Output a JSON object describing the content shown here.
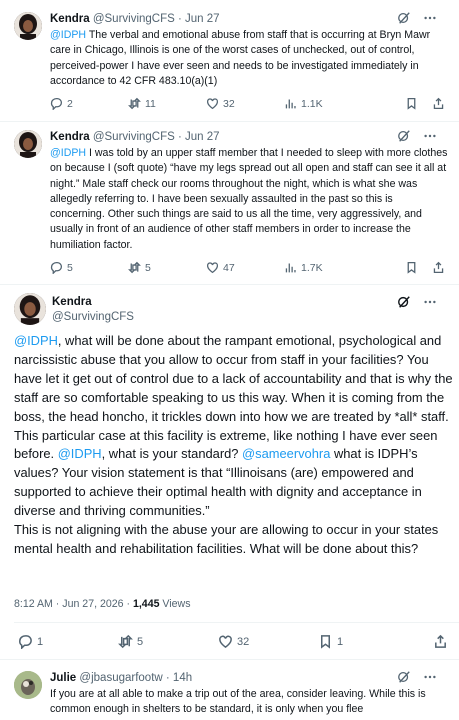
{
  "tweets": [
    {
      "name": "Kendra",
      "handle": "@SurvivingCFS",
      "time": "· Jun 27",
      "mention": "@IDPH",
      "text": " The verbal and emotional abuse from staff that is occurring at Bryn Mawr care in Chicago, Illinois is one of the worst cases of unchecked, out of control, perceived-power I have ever seen and needs to be investigated immediately in accordance to 42 CFR 483.10(a)(1)",
      "replies": "2",
      "retweets": "11",
      "likes": "32",
      "views": "1.1K"
    },
    {
      "name": "Kendra",
      "handle": "@SurvivingCFS",
      "time": "· Jun 27",
      "mention": "@IDPH",
      "text": " I was told by an upper staff member that I needed to sleep with more clothes on because I (soft quote) “have my legs spread out all open and staff can see it all at night.” Male staff check our rooms throughout the night, which is what she was allegedly referring to. I have been sexually assaulted in the past so this is concerning. Other such things are said to us all the time, very aggressively, and usually in front of an audience of other staff members in order to increase the humiliation factor.",
      "replies": "5",
      "retweets": "5",
      "likes": "47",
      "views": "1.7K"
    }
  ],
  "main_tweet": {
    "name": "Kendra",
    "handle": "@SurvivingCFS",
    "mention1": "@IDPH",
    "text1": ", what will be done about the rampant emotional, psychological and narcissistic abuse that you allow to occur from staff in your facilities? You have let it get out of control due to a lack of accountability and that is why the staff are so comfortable speaking to us this way. When it is coming from the boss, the head honcho, it trickles down into how we are treated by *all* staff. This particular case at this facility is extreme, like nothing I have ever seen before. ",
    "mention2": "@IDPH",
    "text2": ", what is your standard? ",
    "mention3": "@sameervohra",
    "text3": " what is IDPH’s values? Your vision statement is that “Illinoisans (are) empowered and supported to achieve their optimal health with dignity and acceptance in diverse and thriving communities.”",
    "text4": "This is not aligning with the abuse your are allowing to occur in your states mental health and rehabilitation facilities. What will be done about this?",
    "timestamp": "8:12 AM · Jun 27, 2026 · ",
    "views_count": "1,445",
    "views_label": " Views",
    "replies": "1",
    "retweets": "5",
    "likes": "32",
    "bookmarks": "1"
  },
  "reply": {
    "name": "Julie",
    "handle": "@jbasugarfootw",
    "time": "· 14h",
    "text": "If you are at all able to make a trip out of the area, consider leaving. While this is common enough in shelters to be standard, it is only when you flee"
  },
  "colors": {
    "accent": "#1d9bf0",
    "muted": "#536471",
    "text": "#0f1419",
    "border": "#eff3f4"
  }
}
